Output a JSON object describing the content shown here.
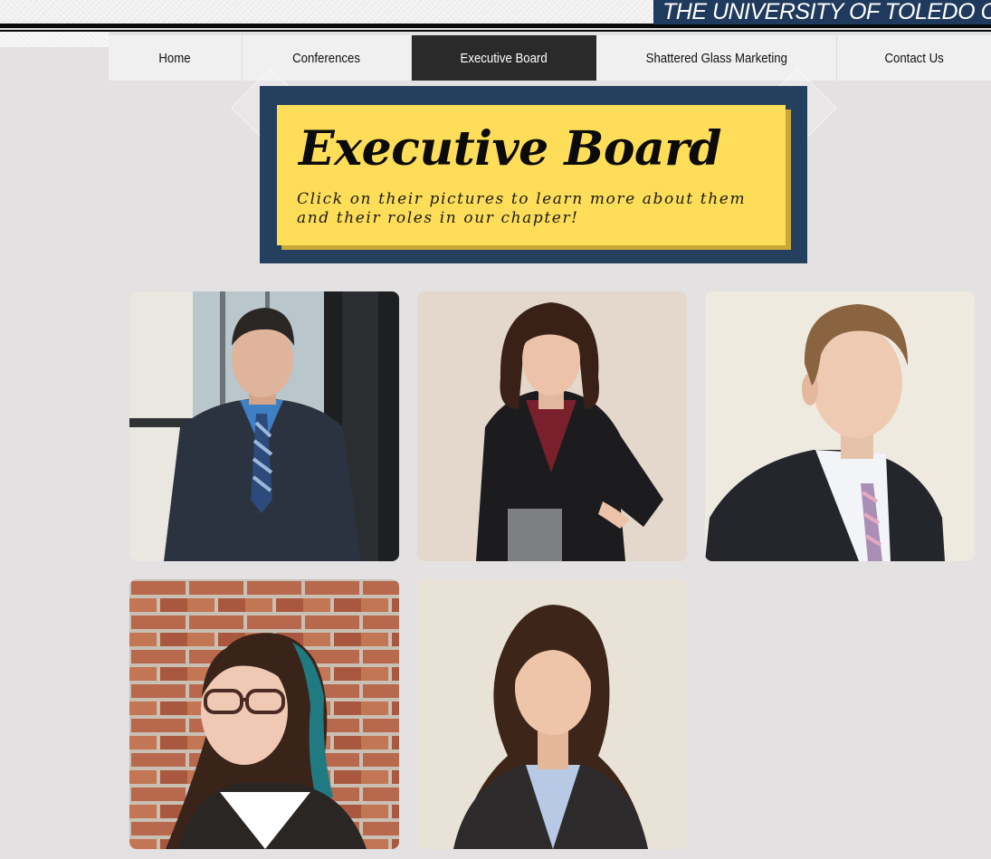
{
  "header": {
    "chapter_title": "THE UNIVERSITY OF TOLEDO CHAPTER"
  },
  "nav": {
    "items": [
      {
        "label": "Home",
        "active": false
      },
      {
        "label": "Conferences",
        "active": false
      },
      {
        "label": "Executive Board",
        "active": true
      },
      {
        "label": "Shattered Glass Marketing",
        "active": false
      },
      {
        "label": "Contact Us",
        "active": false
      }
    ]
  },
  "hero": {
    "title": "Executive Board",
    "subtitle_line1": "Click on their pictures to learn more about them",
    "subtitle_line2": "and their roles in our chapter!"
  },
  "colors": {
    "navy": "#25405e",
    "banner_blue": "#1f3a5c",
    "yellow": "#fedd58",
    "nav_active": "#2a2a2a",
    "page_background": "#e3e1e2"
  },
  "gallery": {
    "photos": [
      {
        "name": "board-member-photo-1"
      },
      {
        "name": "board-member-photo-2"
      },
      {
        "name": "board-member-photo-3"
      },
      {
        "name": "board-member-photo-4"
      },
      {
        "name": "board-member-photo-5"
      }
    ]
  }
}
